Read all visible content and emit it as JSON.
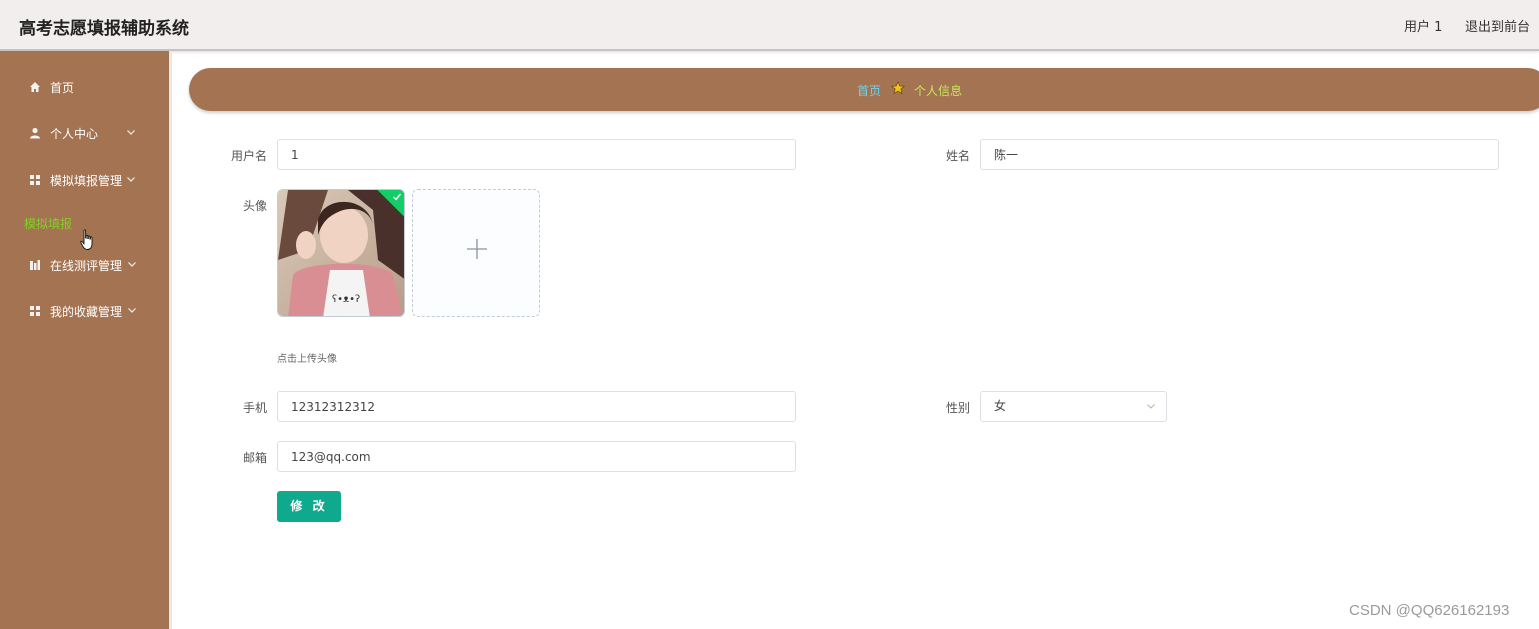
{
  "header": {
    "app_title": "高考志愿填报辅助系统",
    "user_label": "用户 1",
    "exit_label": "退出到前台"
  },
  "sidebar": {
    "items": [
      {
        "label": "首页",
        "icon": "home-icon"
      },
      {
        "label": "个人中心",
        "icon": "user-icon"
      },
      {
        "label": "模拟填报管理",
        "icon": "grid-icon"
      },
      {
        "label": "在线测评管理",
        "icon": "chart-icon"
      },
      {
        "label": "我的收藏管理",
        "icon": "grid-icon"
      }
    ],
    "sub_item": "模拟填报"
  },
  "breadcrumb": {
    "home": "首页",
    "current": "个人信息"
  },
  "form": {
    "username_label": "用户名",
    "username_value": "1",
    "name_label": "姓名",
    "name_value": "陈一",
    "avatar_label": "头像",
    "upload_hint": "点击上传头像",
    "upload_plus": "+",
    "phone_label": "手机",
    "phone_value": "12312312312",
    "gender_label": "性别",
    "gender_value": "女",
    "email_label": "邮箱",
    "email_value": "123@qq.com",
    "submit_label": "修 改"
  },
  "watermark": "CSDN @QQ626162193",
  "colors": {
    "sidebar_bg": "#a47352",
    "submit_bg": "#0fa98e",
    "active_sub": "#7ed321"
  }
}
